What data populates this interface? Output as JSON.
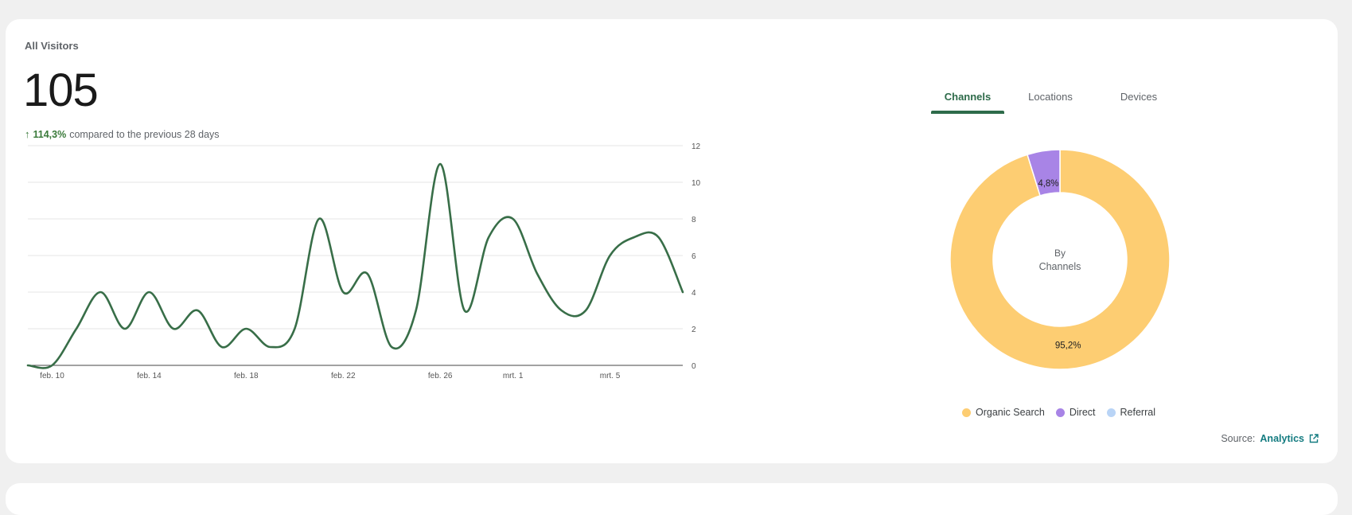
{
  "card": {
    "title": "All Visitors",
    "total": "105",
    "change_pct": "114,3%",
    "change_text": "compared to the previous 28 days"
  },
  "tabs": [
    {
      "label": "Channels",
      "active": true
    },
    {
      "label": "Locations",
      "active": false
    },
    {
      "label": "Devices",
      "active": false
    }
  ],
  "donut": {
    "center_line1": "By",
    "center_line2": "Channels"
  },
  "legend": [
    {
      "label": "Organic Search",
      "color": "#fdcd72"
    },
    {
      "label": "Direct",
      "color": "#a884e6"
    },
    {
      "label": "Referral",
      "color": "#b9d4f6"
    }
  ],
  "source": {
    "label": "Source:",
    "link": "Analytics"
  },
  "colors": {
    "line": "#386e48",
    "accent": "#2e6b4a"
  },
  "chart_data": [
    {
      "type": "line",
      "x": [
        "feb. 9",
        "feb. 10",
        "feb. 11",
        "feb. 12",
        "feb. 13",
        "feb. 14",
        "feb. 15",
        "feb. 16",
        "feb. 17",
        "feb. 18",
        "feb. 19",
        "feb. 20",
        "feb. 21",
        "feb. 22",
        "feb. 23",
        "feb. 24",
        "feb. 25",
        "feb. 26",
        "feb. 27",
        "feb. 28",
        "mrt. 1",
        "mrt. 2",
        "mrt. 3",
        "mrt. 4",
        "mrt. 5",
        "mrt. 6",
        "mrt. 7"
      ],
      "x_tick_labels": [
        "feb. 10",
        "feb. 14",
        "feb. 18",
        "feb. 22",
        "feb. 26",
        "mrt. 1",
        "mrt. 5"
      ],
      "y_ticks": [
        "0",
        "2",
        "4",
        "6",
        "8",
        "10",
        "12"
      ],
      "series": [
        {
          "values": [
            0,
            0,
            2,
            4,
            2,
            4,
            2,
            3,
            1,
            2,
            1,
            2,
            8,
            4,
            5,
            1,
            3,
            11,
            3,
            7,
            8,
            5,
            3,
            3,
            6,
            7,
            7,
            4
          ]
        }
      ],
      "ylim": [
        0,
        12
      ],
      "y_axis_position": "right",
      "grid": true
    },
    {
      "type": "pie",
      "variant": "donut",
      "categories": [
        "Organic Search",
        "Direct",
        "Referral"
      ],
      "values": [
        95.2,
        4.8,
        0
      ],
      "labels": [
        "95,2%",
        "4,8%",
        ""
      ]
    }
  ]
}
